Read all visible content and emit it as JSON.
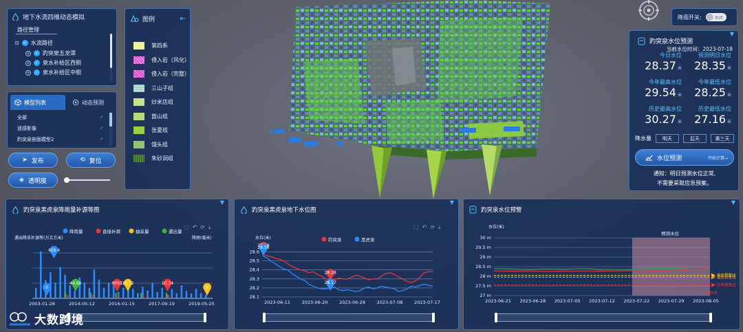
{
  "tree": {
    "title": "地下水流四维动态模拟",
    "tab": "路径管理",
    "root": "水流路径",
    "items": [
      "趵突泉五龙潭",
      "泉水补给区西侧",
      "泉水补给区中侧"
    ]
  },
  "models": {
    "tabs": [
      "模型列表",
      "动态预测"
    ],
    "rows": [
      "全部",
      "遥感影像",
      "趵突泉剖面模型2"
    ]
  },
  "buttons": {
    "publish": "发布",
    "reset": "复位",
    "transparency": "透明度"
  },
  "transparency_slider": 0.05,
  "legend": {
    "title": "图例",
    "items": [
      {
        "label": "第四系",
        "color": "#e9f274",
        "pattern": "dots"
      },
      {
        "label": "侵入岩（风化）",
        "color": "#d85ad0",
        "pattern": "cross"
      },
      {
        "label": "侵入岩（完整）",
        "color": "#d04fc9",
        "pattern": "cross"
      },
      {
        "label": "三山子组",
        "color": "#9fd0c4",
        "pattern": "grid"
      },
      {
        "label": "炒米店组",
        "color": "#c9e389",
        "pattern": "plain"
      },
      {
        "label": "崮山组",
        "color": "#b7db7a",
        "pattern": "plain"
      },
      {
        "label": "张夏组",
        "color": "#9ad03a",
        "pattern": "plain"
      },
      {
        "label": "馒头组",
        "color": "#91c36a",
        "pattern": "plain"
      },
      {
        "label": "朱砂洞组",
        "color": "#4e8a2e",
        "pattern": "stripes"
      }
    ]
  },
  "rain_switch": {
    "label": "降雨开关:",
    "state": "关闭"
  },
  "forecast": {
    "title": "趵突泉水位预测",
    "date_label": "当前水位时间：2023-07-18",
    "stats": [
      {
        "label": "今日水位",
        "value": "28.37",
        "unit": "米"
      },
      {
        "label": "预测明日水位",
        "value": "28.35",
        "unit": "米"
      },
      {
        "label": "今年最高水位",
        "value": "29.54",
        "unit": "米"
      },
      {
        "label": "今年最低水位",
        "value": "28.25",
        "unit": "米"
      },
      {
        "label": "历史最高水位",
        "value": "30.27",
        "unit": "米"
      },
      {
        "label": "历史最低水位",
        "value": "27.16",
        "unit": "米"
      }
    ],
    "rain_label": "降水量",
    "days": [
      "明天",
      "后天",
      "第三天"
    ],
    "predict_btn": "水位预测",
    "predict_sub": "开始计算→",
    "notice_1": "通知：明日预测水位正常,",
    "notice_2": "不需要采取应急预案。"
  },
  "chart_data": [
    {
      "type": "bar",
      "title": "趵突泉黑虎泉降雨量补源等图",
      "ylabel_left": "遇出降采补源等(万立方米)",
      "ylabel_right": "降雨(毫米)",
      "legend": [
        "降雨量",
        "直接补源",
        "抽采量",
        "遇出量"
      ],
      "colors": [
        "#2a8cff",
        "#e8363a",
        "#f3c21b",
        "#3fb43f"
      ],
      "x_ticks": [
        "2003-01-28",
        "2014-05-12",
        "2016-01-15",
        "2017-09-19",
        "2019-05-25"
      ],
      "markers": [
        {
          "value": "426.4",
          "color": "#2a8cff",
          "pos": 0.12
        },
        {
          "value": "44.66",
          "color": "#3fb43f",
          "pos": 0.24
        },
        {
          "value": "0",
          "color": "#2a8cff",
          "pos": 0.08
        },
        {
          "value": "0093",
          "color": "#e8363a",
          "pos": 0.47
        },
        {
          "value": "15.72",
          "color": "#f3c21b",
          "pos": 0.53
        },
        {
          "value": "10.54",
          "color": "#e8363a",
          "pos": 0.75
        },
        {
          "value": "0",
          "color": "#f3c21b",
          "pos": 0.97
        }
      ],
      "rain_bars": [
        0.2,
        0.9,
        0.35,
        0.5,
        0.3,
        0.6,
        0.45,
        0.25,
        0.15,
        0.4,
        0.3,
        0.2,
        0.55,
        0.35,
        0.2,
        0.3,
        0.25,
        0.12,
        0.2,
        0.35,
        0.18,
        0.1,
        0.22,
        0.15,
        0.3,
        0.12,
        0.2,
        0.08,
        0.18,
        0.1,
        0.25,
        0.14,
        0.09,
        0.18,
        0.1,
        0.07
      ]
    },
    {
      "type": "line",
      "title": "趵突泉黑虎泉地下水位图",
      "ylabel": "水位(米)",
      "series": [
        {
          "name": "趵突泉",
          "color": "#e8363a"
        },
        {
          "name": "黑虎泉",
          "color": "#2a8cff"
        }
      ],
      "y_ticks": [
        "28.6",
        "28.5",
        "28.4",
        "28.3",
        "28.2",
        "28.1"
      ],
      "ylim": [
        28.1,
        28.65
      ],
      "x_ticks": [
        "2023-06-11",
        "2023-06-20",
        "2023-06-29",
        "2023-07-08",
        "2023-07-17"
      ],
      "red": [
        28.58,
        28.56,
        28.55,
        28.53,
        28.52,
        28.5,
        28.47,
        28.44,
        28.42,
        28.4,
        28.39,
        28.37,
        28.38,
        28.35,
        28.33,
        28.3,
        28.3,
        28.29,
        28.31,
        28.3,
        28.3,
        28.32,
        28.34,
        28.33,
        28.31,
        28.29,
        28.3,
        28.3,
        28.33,
        28.36,
        28.37,
        28.35,
        28.32,
        28.3,
        28.27,
        28.26,
        28.28,
        28.32,
        28.37,
        28.38,
        28.38
      ],
      "blue": [
        28.56,
        28.54,
        28.5,
        28.47,
        28.44,
        28.41,
        28.4,
        28.36,
        28.33,
        28.3,
        28.28,
        28.24,
        28.22,
        28.2,
        28.19,
        28.19,
        28.2,
        28.21,
        28.18,
        28.17,
        28.18,
        28.17,
        28.16,
        28.17,
        28.2,
        28.21,
        28.19,
        28.2,
        28.22,
        28.21,
        28.2,
        28.19,
        28.16,
        28.17,
        28.19,
        28.22,
        28.21,
        28.23,
        28.24,
        28.23,
        28.22
      ],
      "labels": [
        {
          "value": "28.58",
          "series": 0
        },
        {
          "value": "28.56",
          "series": 1
        },
        {
          "value": "28.28",
          "series": 0
        },
        {
          "value": "28.17",
          "series": 1
        }
      ]
    },
    {
      "type": "line",
      "title": "趵突泉水位预警",
      "ylabel": "水位(米)",
      "y_ticks": [
        "30 m",
        "29.5 m",
        "29 m",
        "28.5 m",
        "28 m",
        "27.5 m",
        "27 m"
      ],
      "ylim": [
        27,
        30
      ],
      "x_ticks": [
        "2023-06-21",
        "2023-06-28",
        "2023-07-05",
        "2023-07-12",
        "2023-07-22",
        "2023-07-29",
        "2023-08-05"
      ],
      "forecast_label": "预测水位",
      "thresholds": [
        {
          "label": "黄色预警线",
          "value": 28.05,
          "color": "#f3d21b"
        },
        {
          "label": "橙色预警线",
          "value": 27.95,
          "color": "#f39a1b"
        },
        {
          "label": "红色预警线",
          "value": 27.55,
          "color": "#e8363a"
        }
      ],
      "series_green": [
        28.4,
        28.38,
        28.36,
        28.38,
        28.37,
        28.4,
        28.36,
        28.35,
        28.36,
        28.42,
        28.4,
        28.38,
        28.36
      ],
      "series_red": [
        28.28,
        28.27,
        28.28,
        28.26,
        28.27,
        28.28,
        28.27,
        28.28,
        28.3,
        28.28,
        28.3,
        28.38,
        28.4
      ],
      "unit_tag": "水位线"
    }
  ],
  "watermark": "大数跨境"
}
